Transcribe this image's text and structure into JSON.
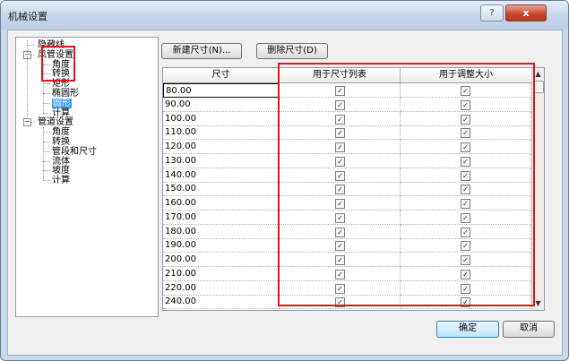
{
  "window": {
    "title": "机械设置",
    "help_label": "?",
    "close_label": "x"
  },
  "tree": [
    {
      "label": "隐藏线",
      "level": 1,
      "toggle": ""
    },
    {
      "label": "风管设置",
      "level": 1,
      "toggle": "−"
    },
    {
      "label": "角度",
      "level": 2,
      "toggle": ""
    },
    {
      "label": "转换",
      "level": 2,
      "toggle": ""
    },
    {
      "label": "矩形",
      "level": 2,
      "toggle": ""
    },
    {
      "label": "椭圆形",
      "level": 2,
      "toggle": ""
    },
    {
      "label": "圆形",
      "level": 2,
      "toggle": "",
      "selected": true
    },
    {
      "label": "计算",
      "level": 2,
      "toggle": ""
    },
    {
      "label": "管道设置",
      "level": 1,
      "toggle": "−"
    },
    {
      "label": "角度",
      "level": 2,
      "toggle": ""
    },
    {
      "label": "转换",
      "level": 2,
      "toggle": ""
    },
    {
      "label": "管段和尺寸",
      "level": 2,
      "toggle": ""
    },
    {
      "label": "流体",
      "level": 2,
      "toggle": ""
    },
    {
      "label": "坡度",
      "level": 2,
      "toggle": ""
    },
    {
      "label": "计算",
      "level": 2,
      "toggle": ""
    }
  ],
  "toolbar": {
    "new_size_label": "新建尺寸(N)...",
    "delete_size_label": "删除尺寸(D)"
  },
  "table": {
    "columns": [
      "尺寸",
      "用于尺寸列表",
      "用于调整大小"
    ],
    "rows": [
      {
        "size": "80.00",
        "in_list": true,
        "in_resize": true
      },
      {
        "size": "90.00",
        "in_list": true,
        "in_resize": true
      },
      {
        "size": "100.00",
        "in_list": true,
        "in_resize": true
      },
      {
        "size": "110.00",
        "in_list": true,
        "in_resize": true
      },
      {
        "size": "120.00",
        "in_list": true,
        "in_resize": true
      },
      {
        "size": "130.00",
        "in_list": true,
        "in_resize": true
      },
      {
        "size": "140.00",
        "in_list": true,
        "in_resize": true
      },
      {
        "size": "150.00",
        "in_list": true,
        "in_resize": true
      },
      {
        "size": "160.00",
        "in_list": true,
        "in_resize": true
      },
      {
        "size": "170.00",
        "in_list": true,
        "in_resize": true
      },
      {
        "size": "180.00",
        "in_list": true,
        "in_resize": true
      },
      {
        "size": "190.00",
        "in_list": true,
        "in_resize": true
      },
      {
        "size": "200.00",
        "in_list": true,
        "in_resize": true
      },
      {
        "size": "210.00",
        "in_list": true,
        "in_resize": true
      },
      {
        "size": "220.00",
        "in_list": true,
        "in_resize": true
      },
      {
        "size": "240.00",
        "in_list": true,
        "in_resize": true
      }
    ]
  },
  "footer": {
    "ok_label": "确定",
    "cancel_label": "取消"
  },
  "colors": {
    "highlight_box": "#e0161b",
    "selection": "#3399ff"
  }
}
